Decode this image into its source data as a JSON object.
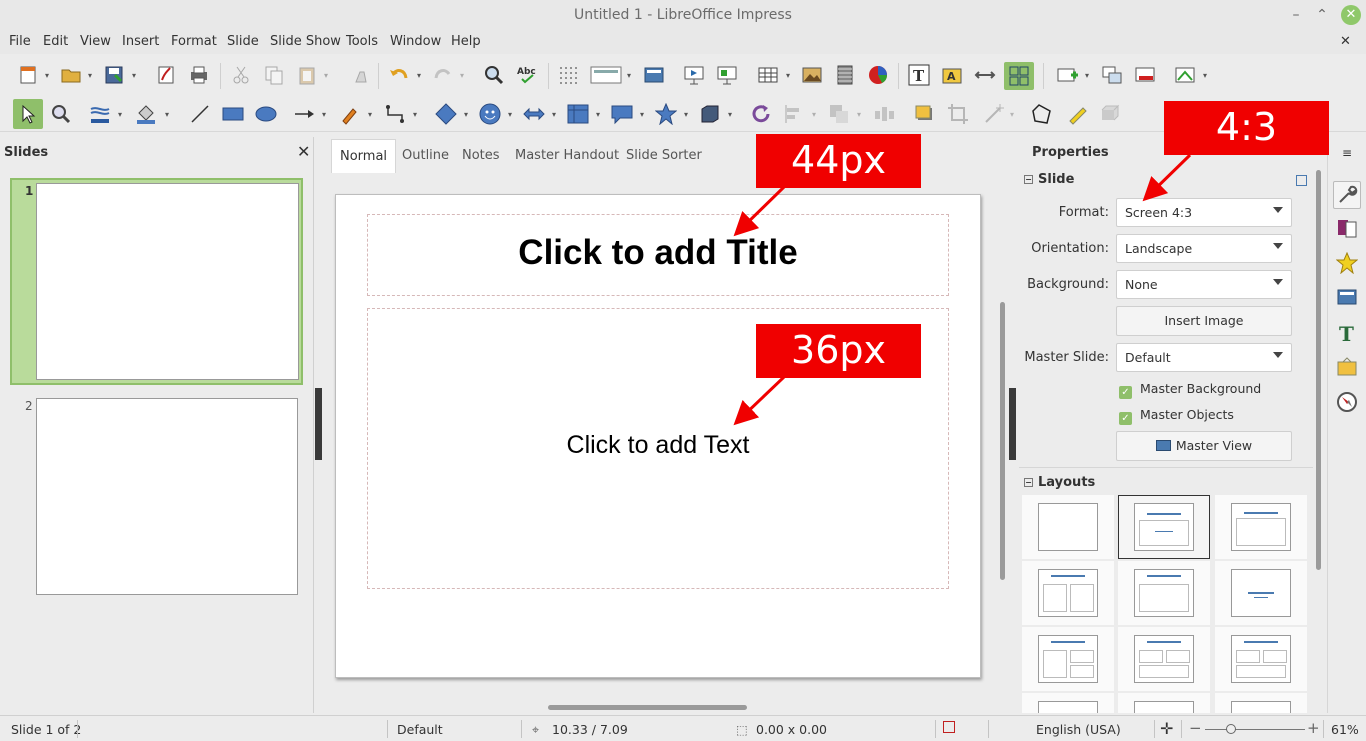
{
  "window": {
    "title": "Untitled 1 - LibreOffice Impress"
  },
  "menu": [
    "File",
    "Edit",
    "View",
    "Insert",
    "Format",
    "Slide",
    "Slide Show",
    "Tools",
    "Window",
    "Help"
  ],
  "slides_panel": {
    "title": "Slides",
    "slides": [
      {
        "number": "1",
        "selected": true
      },
      {
        "number": "2",
        "selected": false
      }
    ]
  },
  "view_tabs": [
    "Normal",
    "Outline",
    "Notes",
    "Master Handout",
    "Slide Sorter"
  ],
  "slide": {
    "title_placeholder": "Click to add Title",
    "body_placeholder": "Click to add Text"
  },
  "annotations": {
    "title_size": "44px",
    "body_size": "36px",
    "format_note": "4:3",
    "color": "#f00000"
  },
  "properties": {
    "title": "Properties",
    "slide_section": {
      "header": "Slide",
      "format_label": "Format:",
      "format_value": "Screen 4:3",
      "orientation_label": "Orientation:",
      "orientation_value": "Landscape",
      "background_label": "Background:",
      "background_value": "None",
      "insert_image": "Insert Image",
      "master_slide_label": "Master Slide:",
      "master_slide_value": "Default",
      "master_background": "Master Background",
      "master_objects": "Master Objects",
      "master_view": "Master View"
    },
    "layouts_header": "Layouts"
  },
  "status": {
    "slide_of": "Slide 1 of 2",
    "master": "Default",
    "position": "10.33 / 7.09",
    "size": "0.00 x 0.00",
    "language": "English (USA)",
    "zoom": "61%"
  },
  "colors": {
    "accent_green": "#8fbf6a",
    "selection_bg": "#b9db9b"
  },
  "icons": {
    "tb1": [
      "new-icon",
      "open-icon",
      "save-icon",
      "export-pdf-icon",
      "print-icon",
      "cut-icon",
      "copy-icon",
      "paste-icon",
      "clone-format-icon",
      "undo-icon",
      "redo-icon",
      "find-replace-icon",
      "spellcheck-icon",
      "grid-icon",
      "display-views-icon",
      "master-slides-icon",
      "start-presentation-icon",
      "start-current-icon",
      "table-icon",
      "image-icon",
      "media-icon",
      "chart-icon",
      "textbox-icon",
      "fontwork-icon",
      "hyperlink-icon",
      "display-grid-icon",
      "new-slide-icon",
      "duplicate-slide-icon",
      "delete-slide-icon",
      "slide-layout-icon"
    ],
    "tb2": [
      "select-icon",
      "zoom-icon",
      "line-color-icon",
      "fill-color-icon",
      "line-icon",
      "rectangle-icon",
      "ellipse-icon",
      "arrow-line-icon",
      "curve-icon",
      "connector-icon",
      "basic-shapes-icon",
      "symbol-shapes-icon",
      "block-arrows-icon",
      "flowchart-icon",
      "callout-icon",
      "stars-icon",
      "3d-objects-icon",
      "rotate-icon",
      "align-icon",
      "arrange-icon",
      "distribute-icon",
      "shadow-icon",
      "crop-icon",
      "filter-icon",
      "points-icon",
      "glue-icon",
      "extrusion-icon"
    ],
    "deck": [
      "properties-icon",
      "slide-transition-icon",
      "animation-icon",
      "master-slides-deck-icon",
      "styles-icon",
      "gallery-icon",
      "navigator-icon"
    ]
  }
}
